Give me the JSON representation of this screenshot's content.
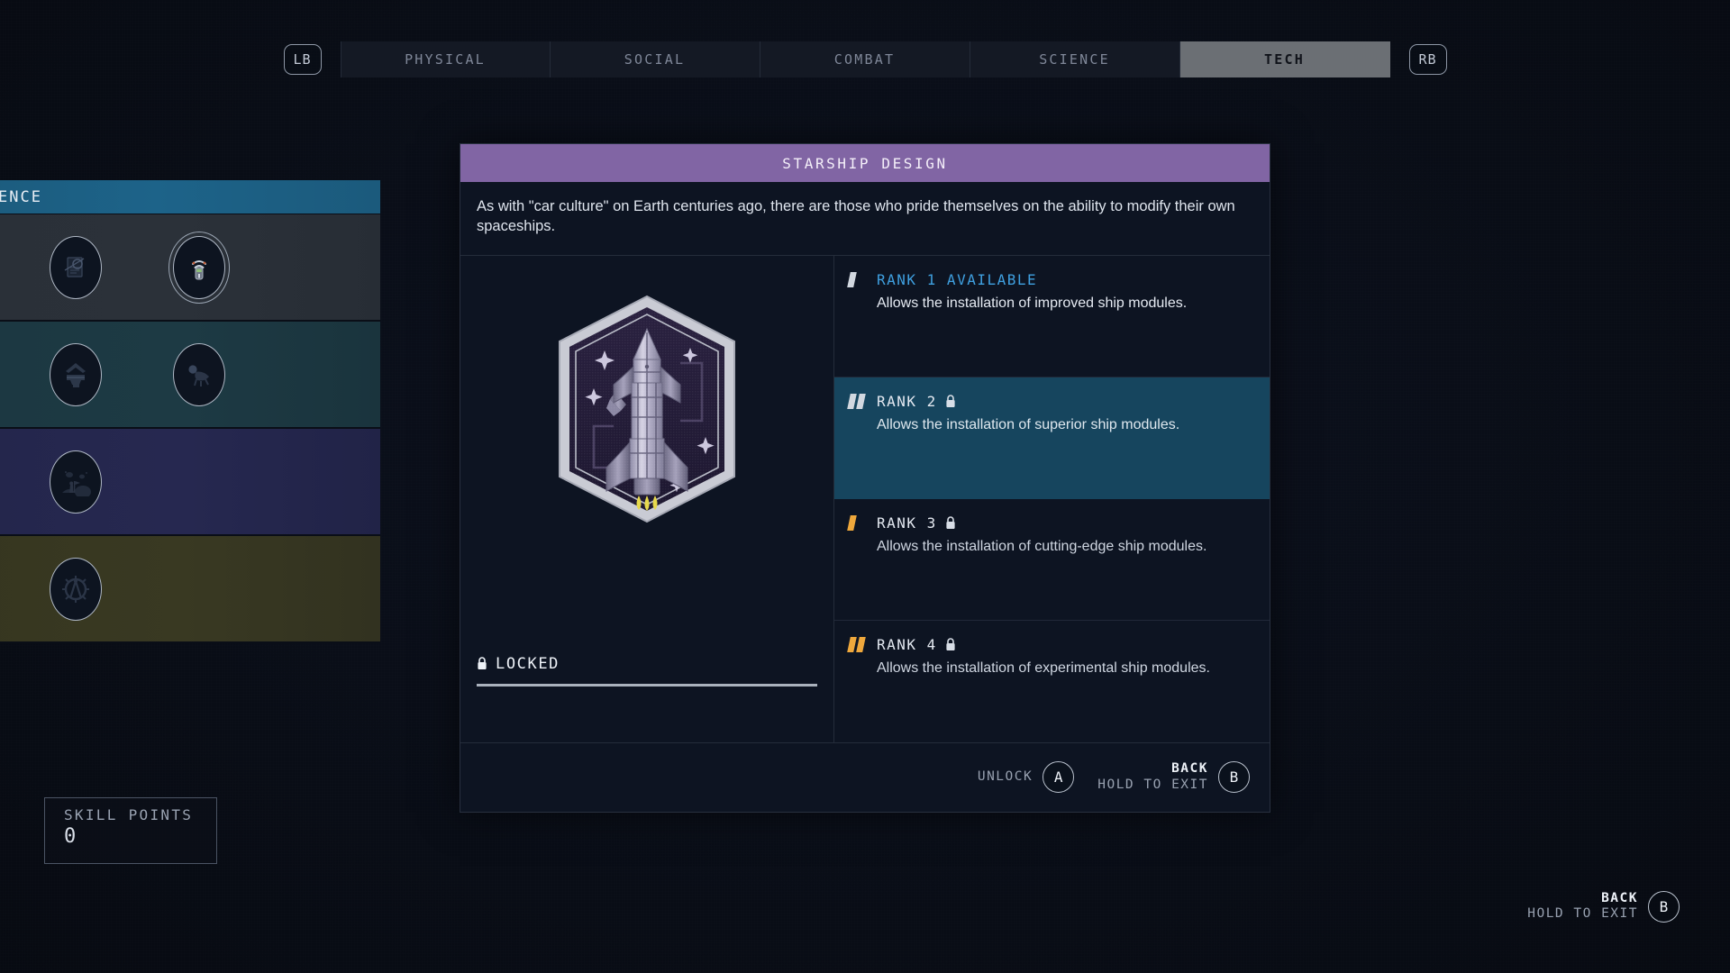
{
  "bumpers": {
    "left": "LB",
    "right": "RB"
  },
  "tabs": [
    {
      "label": "PHYSICAL",
      "active": false
    },
    {
      "label": "SOCIAL",
      "active": false
    },
    {
      "label": "COMBAT",
      "active": false
    },
    {
      "label": "SCIENCE",
      "active": false
    },
    {
      "label": "TECH",
      "active": true
    }
  ],
  "skill_grid": {
    "header": "ENCE",
    "rows": [
      {
        "tint": "r0",
        "cells": [
          "medical-icon",
          "research-icon",
          "scanner-icon"
        ]
      },
      {
        "tint": "r1",
        "cells": [
          "spacesuit-icon",
          "weapon-engineering-icon",
          "zoology-icon"
        ]
      },
      {
        "tint": "r2",
        "cells": [
          "chemistry-icon",
          "planetary-habitation-icon",
          ""
        ]
      },
      {
        "tint": "r3",
        "cells": [
          "astrodynamics-icon",
          "engineering-icon",
          ""
        ]
      }
    ]
  },
  "card": {
    "title": "STARSHIP DESIGN",
    "description": "As with \"car culture\" on Earth centuries ago, there are those who pride themselves on the ability to modify their own spaceships.",
    "badge_icon": "starship-badge-icon",
    "status_label": "LOCKED",
    "status_icon": "lock-icon",
    "progress_percent": 0,
    "accent_color": "#8165a4",
    "highlight_color": "#16455e",
    "available_color": "#3fa0e0",
    "pip_silver_color": "#d2d8e0",
    "pip_amber_color": "#efa83c",
    "ranks": [
      {
        "name": "RANK 1 AVAILABLE",
        "description": "Allows the installation of improved ship modules.",
        "pips": 1,
        "pip_style": "silver",
        "locked": false,
        "available": true,
        "highlight": false
      },
      {
        "name": "RANK 2",
        "description": "Allows the installation of superior ship modules.",
        "pips": 2,
        "pip_style": "silver",
        "locked": true,
        "available": false,
        "highlight": true
      },
      {
        "name": "RANK 3",
        "description": "Allows the installation of cutting-edge ship modules.",
        "pips": 1,
        "pip_style": "amber",
        "locked": true,
        "available": false,
        "highlight": false
      },
      {
        "name": "RANK 4",
        "description": "Allows the installation of experimental ship modules.",
        "pips": 2,
        "pip_style": "amber",
        "locked": true,
        "available": false,
        "highlight": false
      }
    ],
    "footer": {
      "unlock_label": "UNLOCK",
      "unlock_button": "A",
      "back_primary": "BACK",
      "back_secondary": "HOLD TO EXIT",
      "back_button": "B"
    }
  },
  "skill_points": {
    "label": "SKILL POINTS",
    "value": "0"
  },
  "exit_prompt": {
    "primary": "BACK",
    "secondary": "HOLD TO EXIT",
    "button": "B"
  }
}
